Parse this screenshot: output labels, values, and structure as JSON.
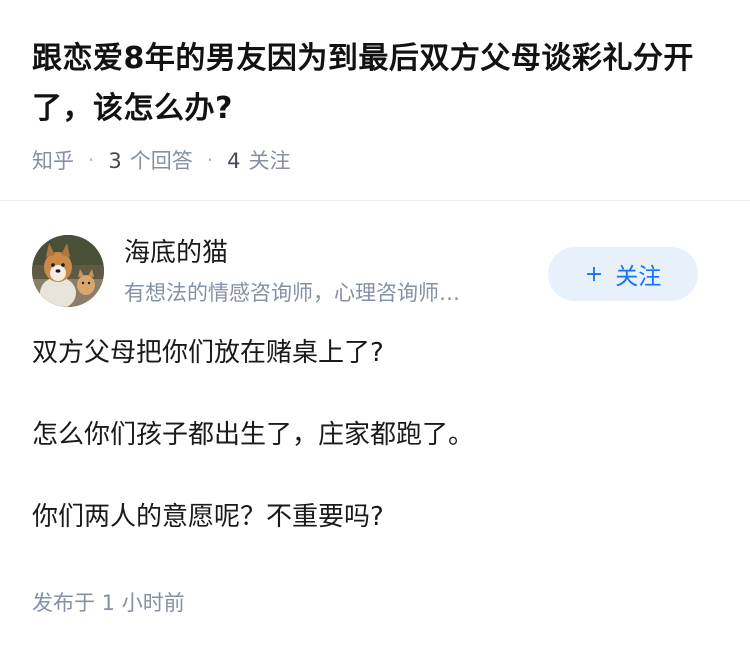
{
  "question": {
    "title": "跟恋爱8年的男友因为到最后双方父母谈彩礼分开了，该怎么办?",
    "source": "知乎",
    "answer_count": "3",
    "answer_label": "个回答",
    "follow_count": "4",
    "follow_label": "关注"
  },
  "answer": {
    "author_name": "海底的猫",
    "author_bio": "有想法的情感咨询师，心理咨询师…",
    "follow_button_label": "关注",
    "follow_button_icon": "plus-icon",
    "paragraphs": [
      "双方父母把你们放在赌桌上了?",
      "怎么你们孩子都出生了，庄家都跑了。",
      "你们两人的意愿呢？不重要吗?"
    ],
    "publish_time": "发布于 1 小时前"
  },
  "colors": {
    "meta_gray": "#8590a6",
    "accent_blue": "#1772f6",
    "follow_bg": "#e8f0fa"
  }
}
